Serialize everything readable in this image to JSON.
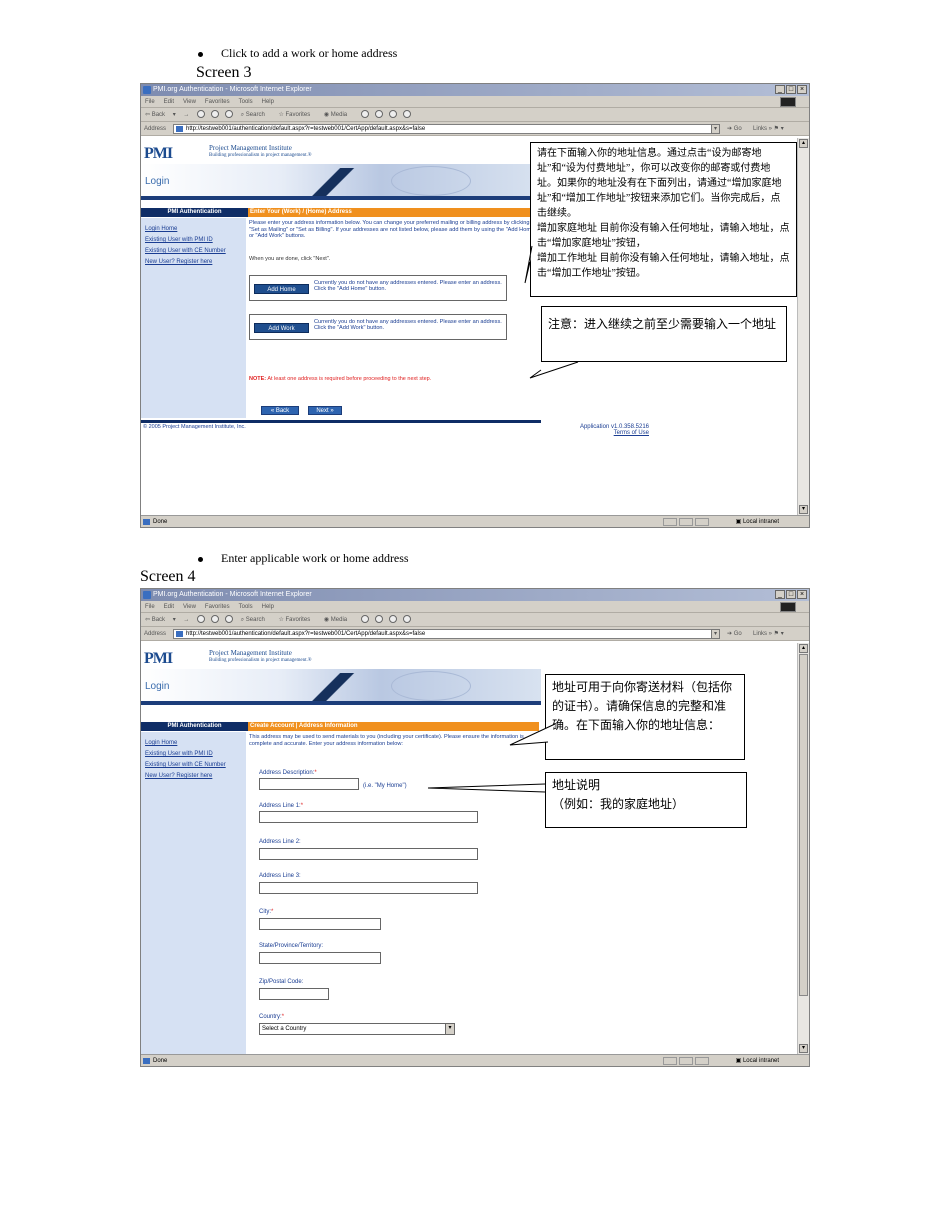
{
  "doc": {
    "bullet1": "Click to add a work or home address",
    "screen3_title": "Screen 3",
    "bullet2": "Enter applicable work or home address",
    "screen4_title": "Screen 4"
  },
  "browser": {
    "window_title": "PMI.org Authentication - Microsoft Internet Explorer",
    "menu": [
      "File",
      "Edit",
      "View",
      "Favorites",
      "Tools",
      "Help"
    ],
    "toolbar": {
      "back": "Back",
      "forward": "→",
      "search": "Search",
      "favorites": "Favorites",
      "media": "Media"
    },
    "address_label": "Address",
    "url3": "http://testweb001/authentication/default.aspx?r=testweb001/CertApp/default.aspx&s=false",
    "url4": "http://testweb001/authentication/default.aspx?r=testweb001/CertApp/default.aspx&s=false",
    "go": "Go",
    "links": "Links",
    "status_done": "Done",
    "status_zone": "Local intranet"
  },
  "pmi": {
    "logo": "PMI",
    "name": "Project Management Institute",
    "tagline": "Building professionalism in project management.®",
    "login": "Login",
    "sidebar_header": "PMI Authentication",
    "sidebar_links": [
      "Login Home",
      "Existing User with PMI ID",
      "Existing User with CE Number",
      "New User? Register here"
    ],
    "copyright": "© 2005 Project Management Institute, Inc.",
    "app_version": "Application v1.0.358.5216",
    "terms": "Terms of Use"
  },
  "screen3": {
    "header": "Enter Your (Work) / (Home) Address",
    "intro": "Please enter your address information below. You can change your preferred mailing or billing address by clicking \"Set as Mailing\" or \"Set as Billing\". If your addresses are not listed below, please add them by using the \"Add Home\" or \"Add Work\" buttons.",
    "when_done": "When you are done, click \"Next\".",
    "add_home": "Add Home",
    "home_text": "Currently you do not have any addresses entered. Please enter an address. Click the \"Add Home\" button.",
    "add_work": "Add Work",
    "work_text": "Currently you do not have any addresses entered. Please enter an address. Click the \"Add Work\" button.",
    "note_label": "NOTE:",
    "note_text": "At least one address is required before proceeding to the next step.",
    "back": "« Back",
    "next": "Next »",
    "callout1": "请在下面输入你的地址信息。通过点击“设为邮寄地址”和“设为付费地址”，你可以改变你的邮寄或付费地址。如果你的地址没有在下面列出，请通过“增加家庭地址”和“增加工作地址”按钮来添加它们。当你完成后，点击继续。\n增加家庭地址 目前你没有输入任何地址，请输入地址，点击“增加家庭地址”按钮，\n增加工作地址 目前你没有输入任何地址，请输入地址，点击“增加工作地址”按钮。",
    "callout2": "注意：进入继续之前至少需要输入一个地址"
  },
  "screen4": {
    "header": "Create Account | Address Information",
    "intro": "This address may be used to send materials to you (including your certificate). Please ensure the information is complete and accurate. Enter your address information below:",
    "fields": {
      "desc": "Address Description:",
      "desc_hint": "(i.e. \"My Home\")",
      "line1": "Address Line 1:",
      "line2": "Address Line 2:",
      "line3": "Address Line 3:",
      "city": "City:",
      "state": "State/Province/Territory:",
      "zip": "Zip/Postal Code:",
      "country": "Country:",
      "country_value": "Select a Country"
    },
    "req": "*",
    "callout1": "地址可用于向你寄送材料（包括你的证书）。请确保信息的完整和准确。在下面输入你的地址信息：",
    "callout2": "地址说明\n（例如：我的家庭地址）"
  },
  "colors": {
    "pmi_blue": "#0f2d66",
    "orange": "#f0901e",
    "sidebar": "#d6e1f3",
    "link": "#1a3d92",
    "note_red": "#e02020"
  }
}
